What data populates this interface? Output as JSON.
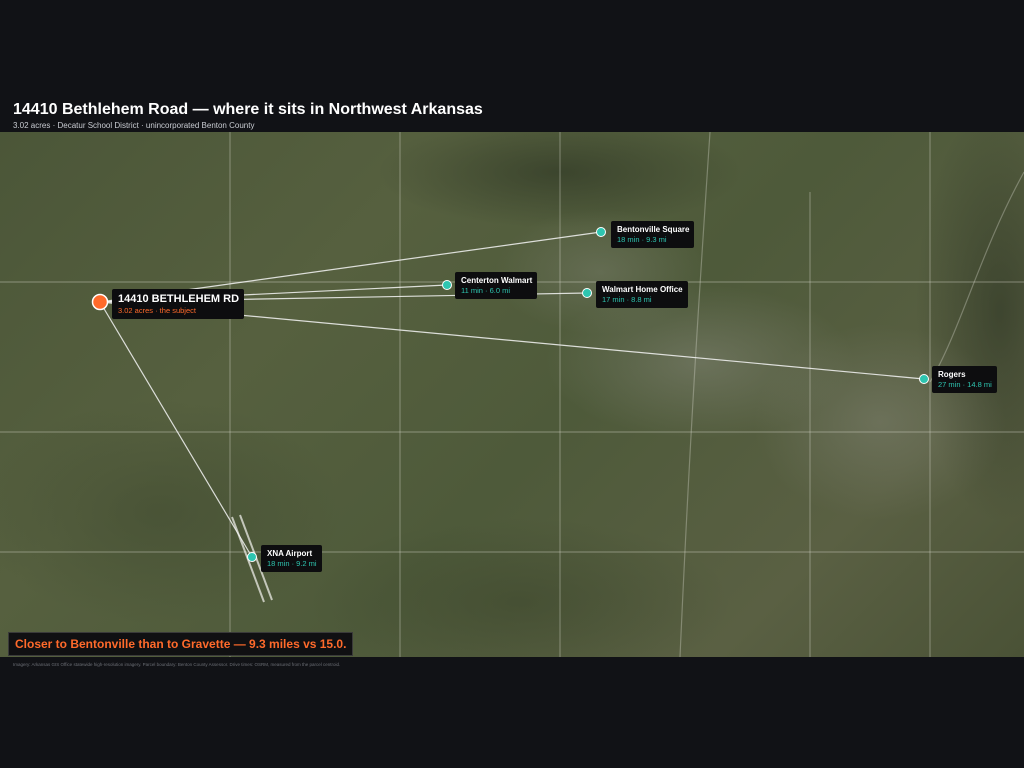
{
  "header": {
    "title": "14410 Bethlehem Road — where it sits in Northwest Arkansas",
    "subtitle": "3.02 acres · Decatur School District · unincorporated Benton County"
  },
  "map": {
    "subject": {
      "name": "14410 BETHLEHEM RD",
      "meta": "3.02 acres · the subject",
      "color": "#ff6a2b"
    },
    "destination_color": "#2ec5b0",
    "destinations": [
      {
        "id": "bentonville-square",
        "name": "Bentonville Square",
        "meta": "18 min · 9.3 mi"
      },
      {
        "id": "centerton-walmart",
        "name": "Centerton Walmart",
        "meta": "11 min · 6.0 mi"
      },
      {
        "id": "walmart-home-office",
        "name": "Walmart Home Office",
        "meta": "17 min · 8.8 mi"
      },
      {
        "id": "rogers",
        "name": "Rogers",
        "meta": "27 min · 14.8 mi"
      },
      {
        "id": "xna-airport",
        "name": "XNA Airport",
        "meta": "18 min · 9.2 mi"
      }
    ]
  },
  "callout": {
    "text": "Closer to Bentonville than to Gravette — 9.3 miles vs 15.0."
  },
  "credits": {
    "text": "Imagery: Arkansas GIS Office statewide high-resolution imagery. Parcel boundary: Benton County Assessor. Drive times: OSRM, measured from the parcel centroid."
  }
}
